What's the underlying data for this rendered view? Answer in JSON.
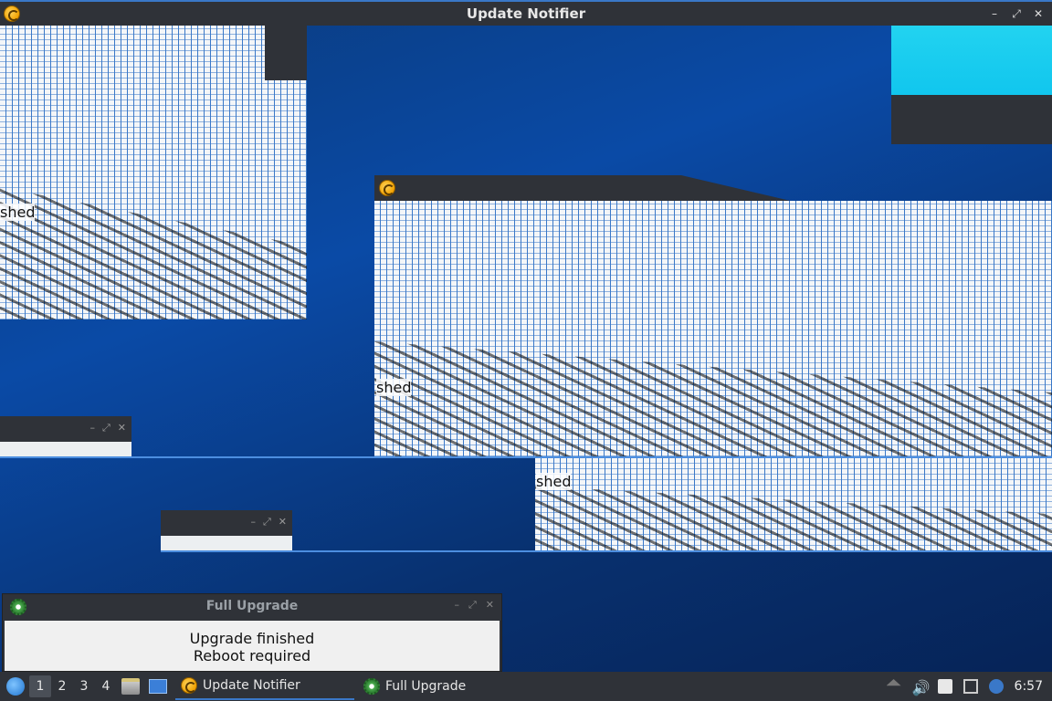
{
  "main_window": {
    "title": "Update Notifier",
    "controls": {
      "minimize": "–",
      "maximize": "⤢",
      "close": "✕"
    }
  },
  "artifacts": {
    "shed_text": "shed"
  },
  "dialog": {
    "title": "Full Upgrade",
    "line1": "Upgrade finished",
    "line2": "Reboot required",
    "controls": {
      "minimize": "–",
      "maximize": "⤢",
      "close": "✕"
    }
  },
  "taskbar": {
    "workspaces": [
      "1",
      "2",
      "3",
      "4"
    ],
    "active_workspace": "1",
    "tasks": [
      {
        "label": "Update Notifier",
        "icon": "update-notifier-icon",
        "active": true
      },
      {
        "label": "Full Upgrade",
        "icon": "gear-icon",
        "active": false
      }
    ],
    "clock": "6:57"
  },
  "colors": {
    "accent": "#3a78c8",
    "titlebar": "#2f3238",
    "desktop": "#0a4aa6",
    "cyan": "#22d3f0"
  }
}
